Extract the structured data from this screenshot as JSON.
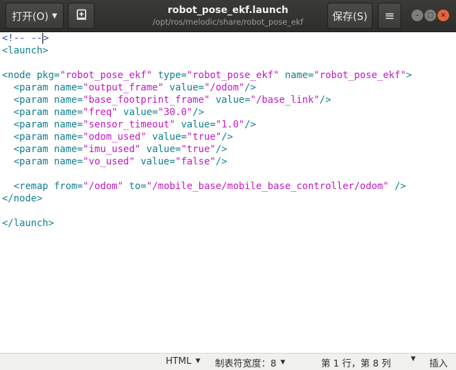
{
  "header": {
    "open_label": "打开(O)",
    "save_label": "保存(S)",
    "title": "robot_pose_ekf.launch",
    "subtitle": "/opt/ros/melodic/share/robot_pose_ekf"
  },
  "icons": {
    "new_tab": "new-tab-icon",
    "menu": "hamburger-menu-icon",
    "minimize": "minimize-icon",
    "maximize": "maximize-icon",
    "close": "close-icon"
  },
  "colors": {
    "headerbar": "#2d2d2b",
    "tag": "#0f7e8c",
    "string": "#c218c2",
    "comment": "#2a4aa6",
    "close_button": "#e9643a"
  },
  "editor": {
    "lines": [
      "<!-- -->",
      "<launch>",
      "",
      "<node pkg=\"robot_pose_ekf\" type=\"robot_pose_ekf\" name=\"robot_pose_ekf\">",
      "  <param name=\"output_frame\" value=\"/odom\"/>",
      "  <param name=\"base_footprint_frame\" value=\"/base_link\"/>",
      "  <param name=\"freq\" value=\"30.0\"/>",
      "  <param name=\"sensor_timeout\" value=\"1.0\"/>",
      "  <param name=\"odom_used\" value=\"true\"/>",
      "  <param name=\"imu_used\" value=\"true\"/>",
      "  <param name=\"vo_used\" value=\"false\"/>",
      "",
      "  <remap from=\"/odom\" to=\"/mobile_base/mobile_base_controller/odom\" />",
      "</node>",
      "",
      "</launch>"
    ],
    "cursor": {
      "line": 1,
      "column": 8
    }
  },
  "status": {
    "language": "HTML",
    "tab_width": "制表符宽度：8",
    "position": "第 1 行，第 8 列",
    "insert_mode": "插入"
  }
}
